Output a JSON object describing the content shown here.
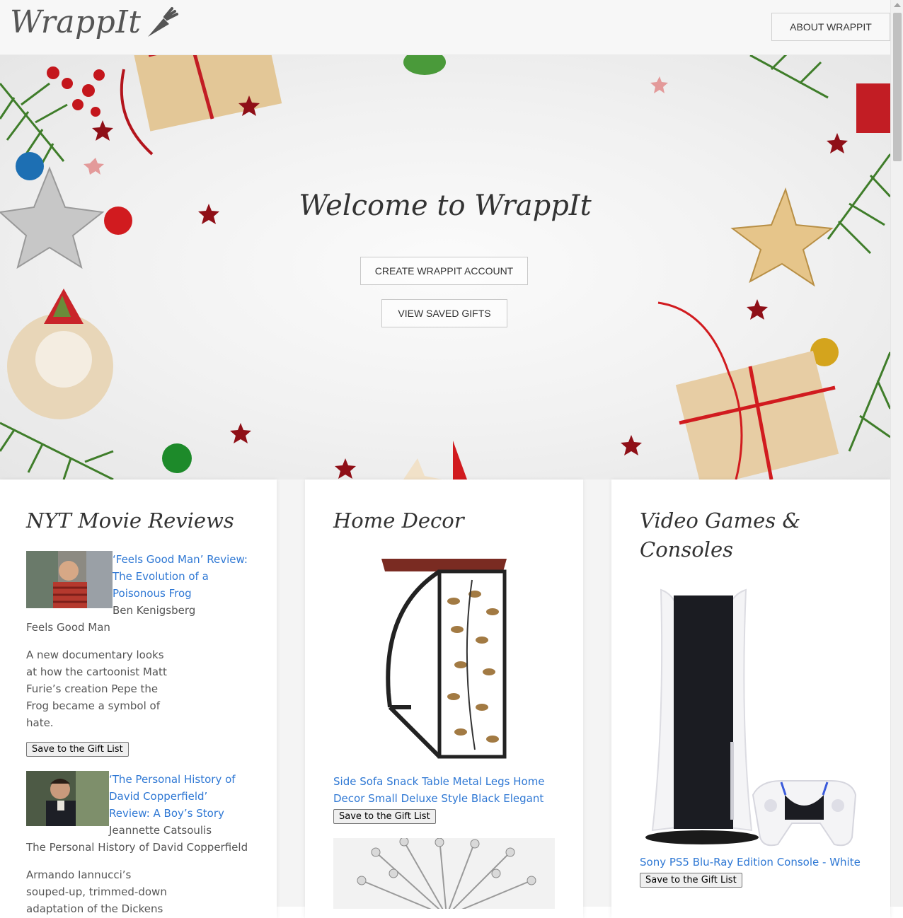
{
  "header": {
    "logo_text": "WrappIt",
    "about_label": "ABOUT WRAPPIT"
  },
  "hero": {
    "title": "Welcome to WrappIt",
    "create_label": "CREATE WRAPPIT ACCOUNT",
    "saved_label": "VIEW SAVED GIFTS"
  },
  "movies": {
    "title": "NYT Movie Reviews",
    "items": [
      {
        "headline": "‘Feels Good Man’ Review: The Evolution of a Poisonous Frog",
        "byline": "Ben Kenigsberg",
        "film": "Feels Good Man",
        "summary": "A new documentary looks at how the cartoonist Matt Furie’s creation Pepe the Frog became a symbol of hate.",
        "button": "Save to the Gift List"
      },
      {
        "headline": "‘The Personal History of David Copperfield’ Review: A Boy’s Story",
        "byline": "Jeannette Catsoulis",
        "film": "The Personal History of David Copperfield",
        "summary": "Armando Iannucci’s souped-up, trimmed-down adaptation of the Dickens",
        "button": "Save to the Gift List"
      }
    ]
  },
  "decor": {
    "title": "Home Decor",
    "items": [
      {
        "name": "Side Sofa Snack Table Metal Legs Home Decor Small Deluxe Style Black Elegant",
        "button": "Save to the Gift List"
      }
    ]
  },
  "games": {
    "title": "Video Games & Consoles",
    "items": [
      {
        "name": "Sony PS5 Blu-Ray Edition Console - White",
        "button": "Save to the Gift List"
      }
    ]
  },
  "colors": {
    "link": "#2f78d4",
    "header_bg": "#f7f7f7",
    "accent_red": "#b3141c"
  }
}
